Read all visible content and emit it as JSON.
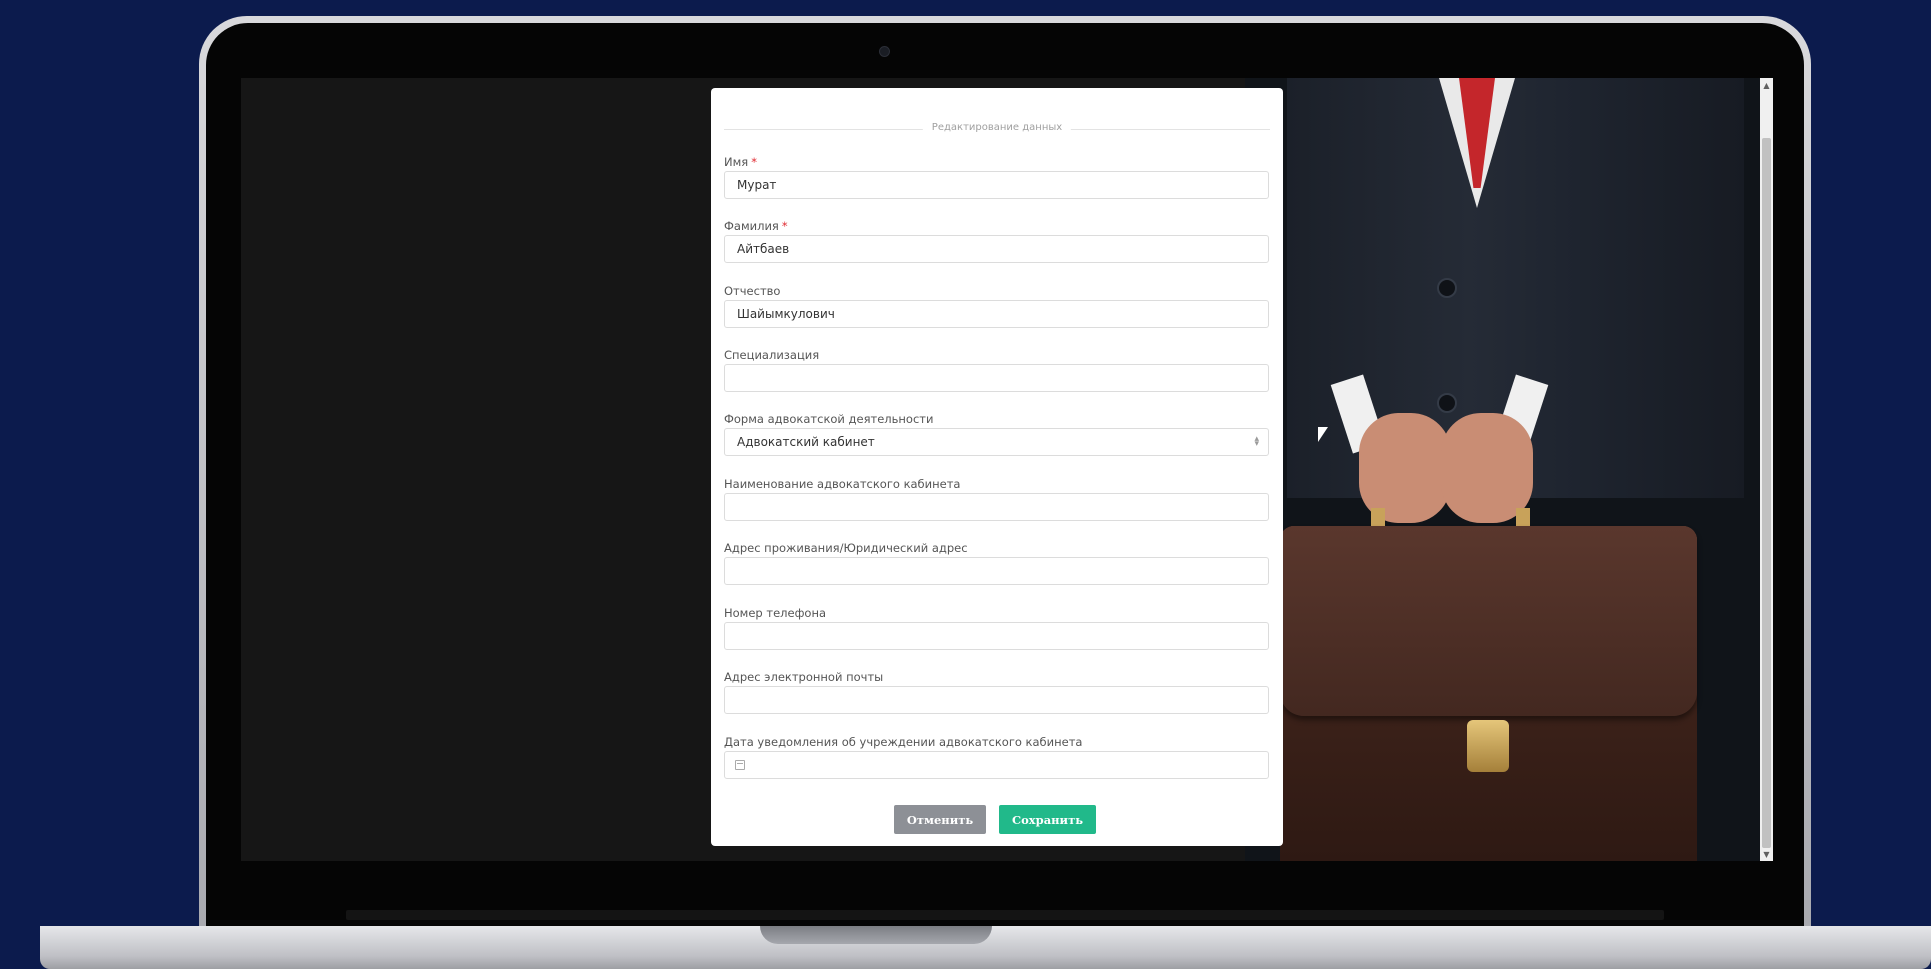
{
  "form": {
    "legend": "Редактирование данных",
    "fields": [
      {
        "label": "Имя",
        "required": true,
        "value": "Мурат"
      },
      {
        "label": "Фамилия",
        "required": true,
        "value": "Айтбаев"
      },
      {
        "label": "Отчество",
        "required": false,
        "value": "Шайымкулович"
      },
      {
        "label": "Специализация",
        "required": false,
        "value": ""
      },
      {
        "label": "Форма адвокатской деятельности",
        "required": false,
        "value": "Адвокатский кабинет",
        "type": "select"
      },
      {
        "label": "Наименование адвокатского кабинета",
        "required": false,
        "value": ""
      },
      {
        "label": "Адрес проживания/Юридический адрес",
        "required": false,
        "value": ""
      },
      {
        "label": "Номер телефона",
        "required": false,
        "value": ""
      },
      {
        "label": "Адрес электронной почты",
        "required": false,
        "value": ""
      },
      {
        "label": "Дата уведомления об учреждении адвокатского кабинета",
        "required": false,
        "value": "",
        "type": "date"
      }
    ],
    "required_mark": "*",
    "cancel_label": "Отменить",
    "save_label": "Сохранить"
  },
  "icons": {
    "select": "chevron-up-down-icon",
    "date": "calendar-icon",
    "scroll_up": "scroll-up-arrow-icon",
    "scroll_down": "scroll-down-arrow-icon",
    "cursor": "mouse-cursor-icon"
  },
  "colors": {
    "page_background": "#0c1b4d",
    "save_button": "#21b98a",
    "cancel_button": "#8d9096",
    "required_mark": "#e0282f"
  }
}
